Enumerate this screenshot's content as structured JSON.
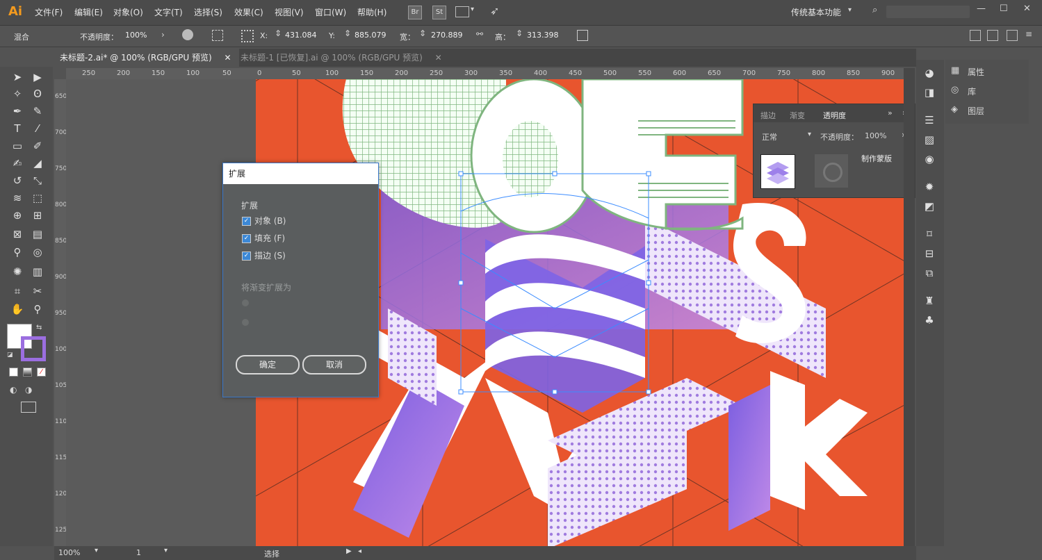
{
  "app": {
    "logo": "Ai",
    "menus": [
      "文件(F)",
      "编辑(E)",
      "对象(O)",
      "文字(T)",
      "选择(S)",
      "效果(C)",
      "视图(V)",
      "窗口(W)",
      "帮助(H)"
    ],
    "bridge_icon": "Br",
    "stock_icon": "St",
    "workspace": "传统基本功能",
    "window_controls": [
      "—",
      "☐",
      "✕"
    ]
  },
  "control_bar": {
    "left_label": "混合",
    "opacity_label": "不透明度：",
    "opacity_value": "100%",
    "x_label": "X:",
    "x_value": "431.084",
    "y_label": "Y:",
    "y_value": "885.079",
    "w_label": "宽：",
    "w_value": "270.889",
    "h_label": "高：",
    "h_value": "313.398"
  },
  "tabs": [
    {
      "label": "未标题-2.ai* @ 100% (RGB/GPU 预览)",
      "close": "✕"
    },
    {
      "label": "未标题-1 [已恢复].ai @ 100% (RGB/GPU 预览)",
      "close": "✕"
    }
  ],
  "h_ruler": [
    "250",
    "200",
    "150",
    "100",
    "50",
    "0",
    "50",
    "100",
    "150",
    "200",
    "250",
    "300",
    "350",
    "400",
    "450",
    "500",
    "550",
    "600",
    "650",
    "700",
    "750",
    "800",
    "850",
    "900"
  ],
  "v_ruler": [
    "650",
    "700",
    "750",
    "800",
    "850",
    "900",
    "950",
    "1000",
    "1050",
    "1100",
    "1150",
    "1200",
    "1250"
  ],
  "dialog": {
    "title": "扩展",
    "section_expand": "扩展",
    "options": [
      {
        "label": "对象 (B)",
        "checked": true
      },
      {
        "label": "填充 (F)",
        "checked": true
      },
      {
        "label": "描边 (S)",
        "checked": true
      }
    ],
    "gradient_section": "将渐变扩展为",
    "ok_label": "确定",
    "cancel_label": "取消"
  },
  "transparency_panel": {
    "tabs": [
      "描边",
      "渐变",
      "透明度"
    ],
    "blend_mode": "正常",
    "opacity_label": "不透明度：",
    "opacity_value": "100%",
    "make_mask": "制作蒙版"
  },
  "right_panels": [
    {
      "label": "属性",
      "icon": "properties-icon"
    },
    {
      "label": "库",
      "icon": "library-icon"
    },
    {
      "label": "图层",
      "icon": "layers-icon"
    }
  ],
  "status_bar": {
    "zoom": "100%",
    "page": "1",
    "mode": "选择"
  },
  "colors": {
    "artboard": "#e8552e",
    "purple": "#9b6ee0",
    "green": "#7fb57f",
    "dialog_border": "#3b78c9"
  }
}
